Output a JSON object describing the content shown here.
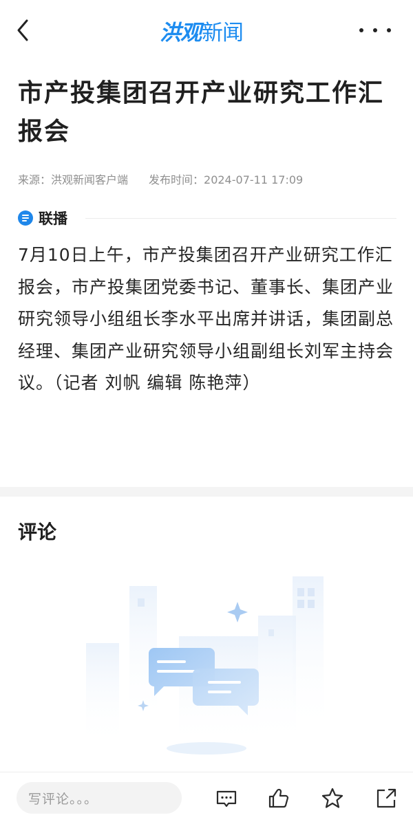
{
  "header": {
    "logo_part1": "洪观",
    "logo_part2": "新闻",
    "back_icon": "chevron-left-icon",
    "more_icon": "more-horizontal-icon"
  },
  "article": {
    "title": "市产投集团召开产业研究工作汇报会",
    "source": "来源：洪观新闻客户端",
    "publish_time": "发布时间：2024-07-11 17:09",
    "column_name": "联播",
    "body": "7月10日上午，市产投集团召开产业研究工作汇报会，市产投集团党委书记、董事长、集团产业研究领导小组组长李水平出席并讲话，集团副总经理、集团产业研究领导小组副组长刘军主持会议。（记者 刘帆 编辑 陈艳萍）"
  },
  "comments": {
    "title": "评论"
  },
  "bottom_bar": {
    "input_placeholder": "写评论。。。",
    "icons": [
      "comment-icon",
      "thumbs-up-icon",
      "star-icon",
      "share-icon"
    ]
  },
  "colors": {
    "brand": "#1d8cf0",
    "column_badge": "#1f87ea",
    "title_text": "#202020",
    "meta_text": "#8f8f8f"
  }
}
